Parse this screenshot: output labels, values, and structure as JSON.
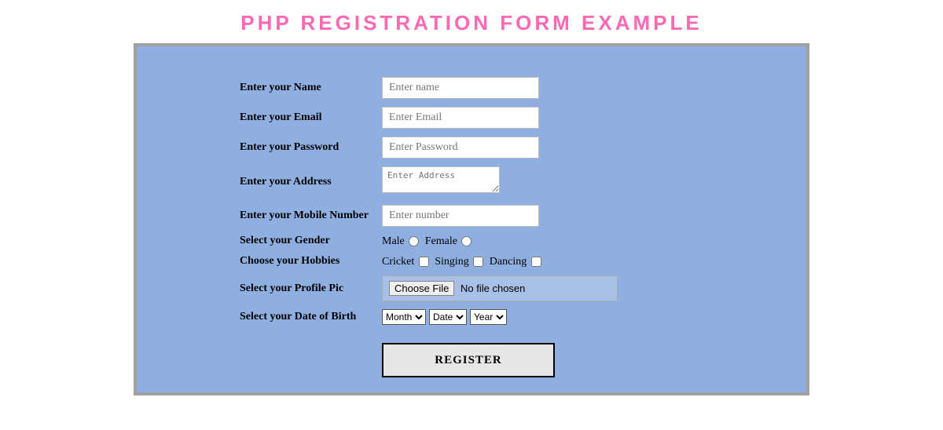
{
  "page": {
    "title": "PHP REGISTRATION FORM EXAMPLE"
  },
  "labels": {
    "name": "Enter your Name",
    "email": "Enter your Email",
    "password": "Enter your Password",
    "address": "Enter your Address",
    "mobile": "Enter your Mobile Number",
    "gender": "Select your Gender",
    "hobbies": "Choose your Hobbies",
    "profilepic": "Select your Profile Pic",
    "dob": "Select your Date of Birth"
  },
  "placeholders": {
    "name": "Enter name",
    "email": "Enter Email",
    "password": "Enter Password",
    "address": "Enter Address",
    "mobile": "Enter number"
  },
  "gender": {
    "male": "Male",
    "female": "Female"
  },
  "hobbies": {
    "cricket": "Cricket",
    "singing": "Singing",
    "dancing": "Dancing"
  },
  "file": {
    "button": "Choose File",
    "status": "No file chosen"
  },
  "dob": {
    "month": "Month",
    "date": "Date",
    "year": "Year"
  },
  "buttons": {
    "register": "REGISTER"
  }
}
